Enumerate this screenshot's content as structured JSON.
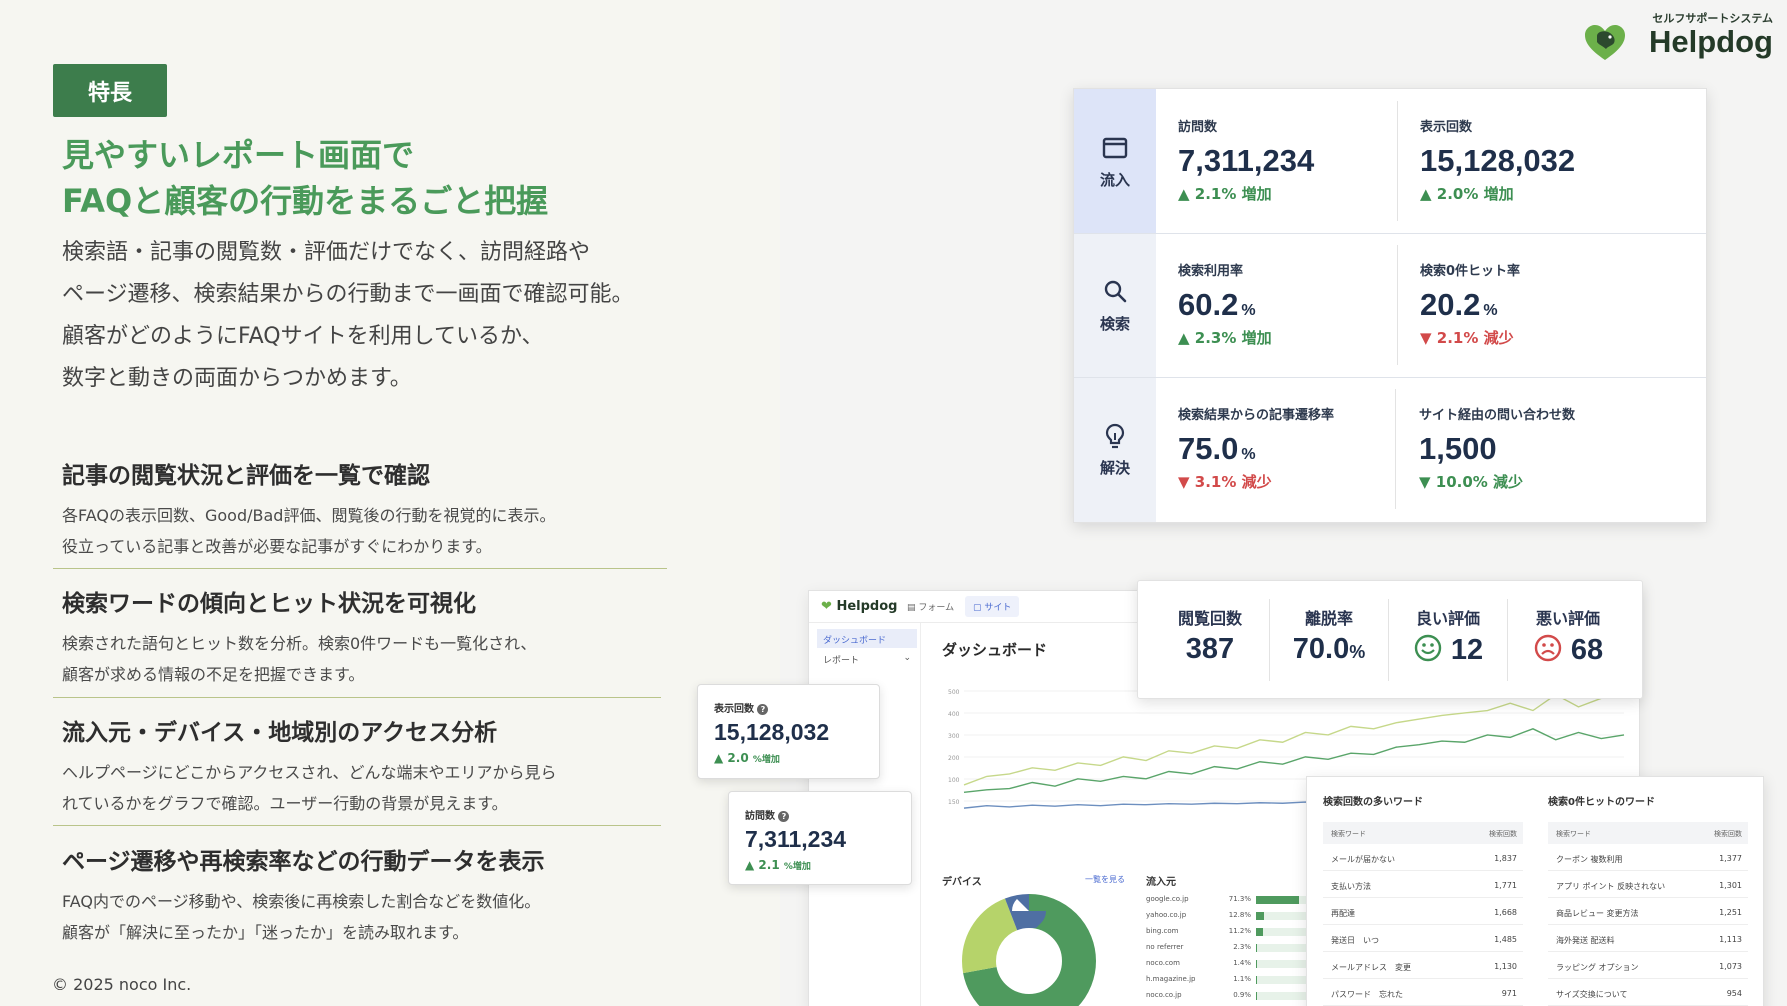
{
  "badge": "特長",
  "headline": [
    "見やすいレポート画面で",
    "FAQと顧客の行動をまるごと把握"
  ],
  "lead": [
    "検索語・記事の閲覧数・評価だけでなく、訪問経路や",
    "ページ遷移、検索結果からの行動まで一画面で確認可能。",
    "顧客がどのようにFAQサイトを利用しているか、",
    "数字と動きの両面からつかめます。"
  ],
  "features": [
    {
      "title": "記事の閲覧状況と評価を一覧で確認",
      "lines": [
        "各FAQの表示回数、Good/Bad評価、閲覧後の行動を視覚的に表示。",
        "役立っている記事と改善が必要な記事がすぐにわかります。"
      ]
    },
    {
      "title": "検索ワードの傾向とヒット状況を可視化",
      "lines": [
        "検索された語句とヒット数を分析。検索0件ワードも一覧化され、",
        "顧客が求める情報の不足を把握できます。"
      ]
    },
    {
      "title": "流入元・デバイス・地域別のアクセス分析",
      "lines": [
        "ヘルプページにどこからアクセスされ、どんな端末やエリアから見ら",
        "れているかをグラフで確認。ユーザー行動の背景が見えます。"
      ]
    },
    {
      "title": "ページ遷移や再検索率などの行動データを表示",
      "lines": [
        "FAQ内でのページ移動や、検索後に再検索した割合などを数値化。",
        "顧客が「解決に至ったか」「迷ったか」を読み取れます。"
      ]
    }
  ],
  "copyright": "© 2025 noco Inc.",
  "logo": {
    "sub": "セルフサポートシステム",
    "name": "Helpdog"
  },
  "kpi_sections": [
    {
      "label": "流入",
      "icon": "window-icon"
    },
    {
      "label": "検索",
      "icon": "search-icon"
    },
    {
      "label": "解決",
      "icon": "lightbulb-icon"
    }
  ],
  "kpis": [
    {
      "title": "訪問数",
      "value": "7,311,234",
      "unit": "",
      "delta": "▲ 2.1% 増加",
      "dir": "up"
    },
    {
      "title": "表示回数",
      "value": "15,128,032",
      "unit": "",
      "delta": "▲ 2.0% 増加",
      "dir": "up"
    },
    {
      "title": "検索利用率",
      "value": "60.2",
      "unit": "%",
      "delta": "▲ 2.3% 増加",
      "dir": "up"
    },
    {
      "title": "検索0件ヒット率",
      "value": "20.2",
      "unit": "%",
      "delta": "▼ 2.1% 減少",
      "dir": "down"
    },
    {
      "title": "検索結果からの記事遷移率",
      "value": "75.0",
      "unit": "%",
      "delta": "▼ 3.1% 減少",
      "dir": "down"
    },
    {
      "title": "サイト経由の問い合わせ数",
      "value": "1,500",
      "unit": "",
      "delta": "▼ 10.0% 減少",
      "dir": "up"
    }
  ],
  "dashboard": {
    "logo": "Helpdog",
    "tabs": [
      "フォーム",
      "サイト"
    ],
    "nav": [
      "ダッシュボード",
      "レポート"
    ],
    "title": "ダッシュボード",
    "device_title": "デバイス",
    "device_link": "一覧を見る",
    "referrer_title": "流入元",
    "referrers": [
      {
        "name": "google.co.jp",
        "pct": "71.3%",
        "value": 71.3
      },
      {
        "name": "yahoo.co.jp",
        "pct": "12.8%",
        "value": 12.8
      },
      {
        "name": "bing.com",
        "pct": "11.2%",
        "value": 11.2
      },
      {
        "name": "no referrer",
        "pct": "2.3%",
        "value": 2.3
      },
      {
        "name": "noco.com",
        "pct": "1.4%",
        "value": 1.4
      },
      {
        "name": "h.magazine.jp",
        "pct": "1.1%",
        "value": 1.1
      },
      {
        "name": "noco.co.jp",
        "pct": "0.9%",
        "value": 0.9
      }
    ]
  },
  "mini_cards": [
    {
      "title": "表示回数",
      "value": "15,128,032",
      "delta": "▲ 2.0",
      "delta_unit": "%増加"
    },
    {
      "title": "訪問数",
      "value": "7,311,234",
      "delta": "▲ 2.1",
      "delta_unit": "%増加"
    }
  ],
  "evaluations": [
    {
      "title": "閲覧回数",
      "value": "387",
      "unit": ""
    },
    {
      "title": "離脱率",
      "value": "70.0",
      "unit": "%"
    },
    {
      "title": "良い評価",
      "value": "12",
      "unit": "",
      "icon": "smile-icon"
    },
    {
      "title": "悪い評価",
      "value": "68",
      "unit": "",
      "icon": "frown-icon"
    }
  ],
  "words": {
    "top": {
      "title": "検索回数の多いワード",
      "col_word": "検索ワード",
      "col_count": "検索回数",
      "rows": [
        [
          "メールが届かない",
          "1,837"
        ],
        [
          "支払い方法",
          "1,771"
        ],
        [
          "再配達",
          "1,668"
        ],
        [
          "発送日　いつ",
          "1,485"
        ],
        [
          "メールアドレス　変更",
          "1,130"
        ],
        [
          "パスワード　忘れた",
          "971"
        ]
      ]
    },
    "zero": {
      "title": "検索0件ヒットのワード",
      "col_word": "検索ワード",
      "col_count": "検索回数",
      "rows": [
        [
          "クーポン 複数利用",
          "1,377"
        ],
        [
          "アプリ ポイント 反映されない",
          "1,301"
        ],
        [
          "商品レビュー 変更方法",
          "1,251"
        ],
        [
          "海外発送 配送料",
          "1,113"
        ],
        [
          "ラッピング オプション",
          "1,073"
        ],
        [
          "サイズ交換について",
          "954"
        ]
      ]
    }
  },
  "chart_data": {
    "type": "line",
    "x": [
      1,
      2,
      3,
      4,
      5,
      6,
      7,
      8,
      9,
      10,
      11,
      12,
      13,
      14,
      15,
      16,
      17,
      18,
      19,
      20,
      21,
      22,
      23,
      24,
      25,
      26,
      27,
      28,
      29,
      30
    ],
    "ylim": [
      0,
      500
    ],
    "yticks": [
      "500",
      "400",
      "300",
      "200",
      "100",
      "150"
    ],
    "series": [
      {
        "color": "#c6d88a",
        "values": [
          115,
          150,
          160,
          185,
          175,
          205,
          195,
          230,
          215,
          255,
          245,
          275,
          265,
          300,
          290,
          330,
          320,
          355,
          345,
          370,
          385,
          400,
          410,
          420,
          450,
          420,
          485,
          435,
          470,
          500
        ]
      },
      {
        "color": "#5aa56a",
        "values": [
          85,
          95,
          100,
          125,
          110,
          140,
          130,
          150,
          140,
          170,
          160,
          190,
          180,
          210,
          200,
          230,
          220,
          245,
          240,
          270,
          280,
          295,
          290,
          320,
          310,
          345,
          300,
          330,
          305,
          320
        ]
      },
      {
        "color": "#6d8fbf",
        "values": [
          20,
          30,
          25,
          32,
          28,
          34,
          30,
          36,
          34,
          38,
          36,
          40,
          38,
          42,
          40,
          45,
          43,
          48,
          46,
          50,
          48,
          52,
          50,
          54,
          52,
          56,
          55,
          58,
          56,
          60
        ]
      }
    ]
  },
  "device_donut": {
    "segments": [
      {
        "value": 72,
        "color": "#4f9a5e"
      },
      {
        "value": 22,
        "color": "#b6d36a"
      },
      {
        "value": 6,
        "color": "#4f6fa3"
      }
    ]
  }
}
